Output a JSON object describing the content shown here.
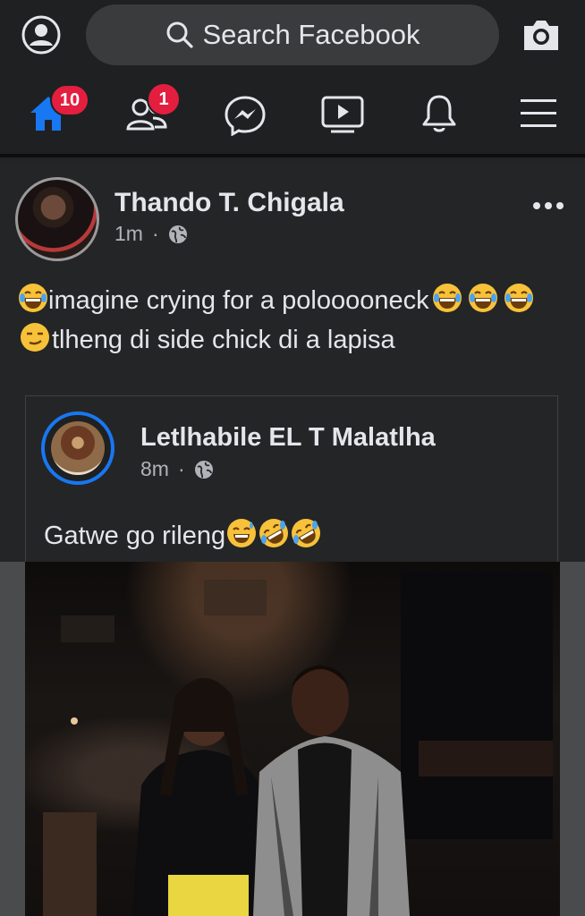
{
  "search": {
    "label": "Search Facebook"
  },
  "nav": {
    "home_badge": "10",
    "friends_badge": "1"
  },
  "post": {
    "author": "Thando T. Chigala",
    "time": "1m",
    "text_parts": {
      "a": "imagine crying for a polooooneck",
      "b": "tlheng di side chick di a lapisa"
    }
  },
  "shared_post": {
    "author": "Letlhabile EL T Malatlha",
    "time": "8m",
    "text": "Gatwe go rileng"
  },
  "colors": {
    "accent": "#1877f2",
    "badge": "#e41e3f",
    "background": "#242526"
  },
  "icons": [
    "profile-icon",
    "search-icon",
    "camera-icon",
    "home-icon",
    "friends-icon",
    "messenger-icon",
    "watch-icon",
    "bell-icon",
    "menu-icon",
    "globe-icon",
    "laughing-emoji-icon",
    "smirk-emoji-icon",
    "rofl-emoji-icon",
    "sweat-smile-emoji-icon"
  ]
}
